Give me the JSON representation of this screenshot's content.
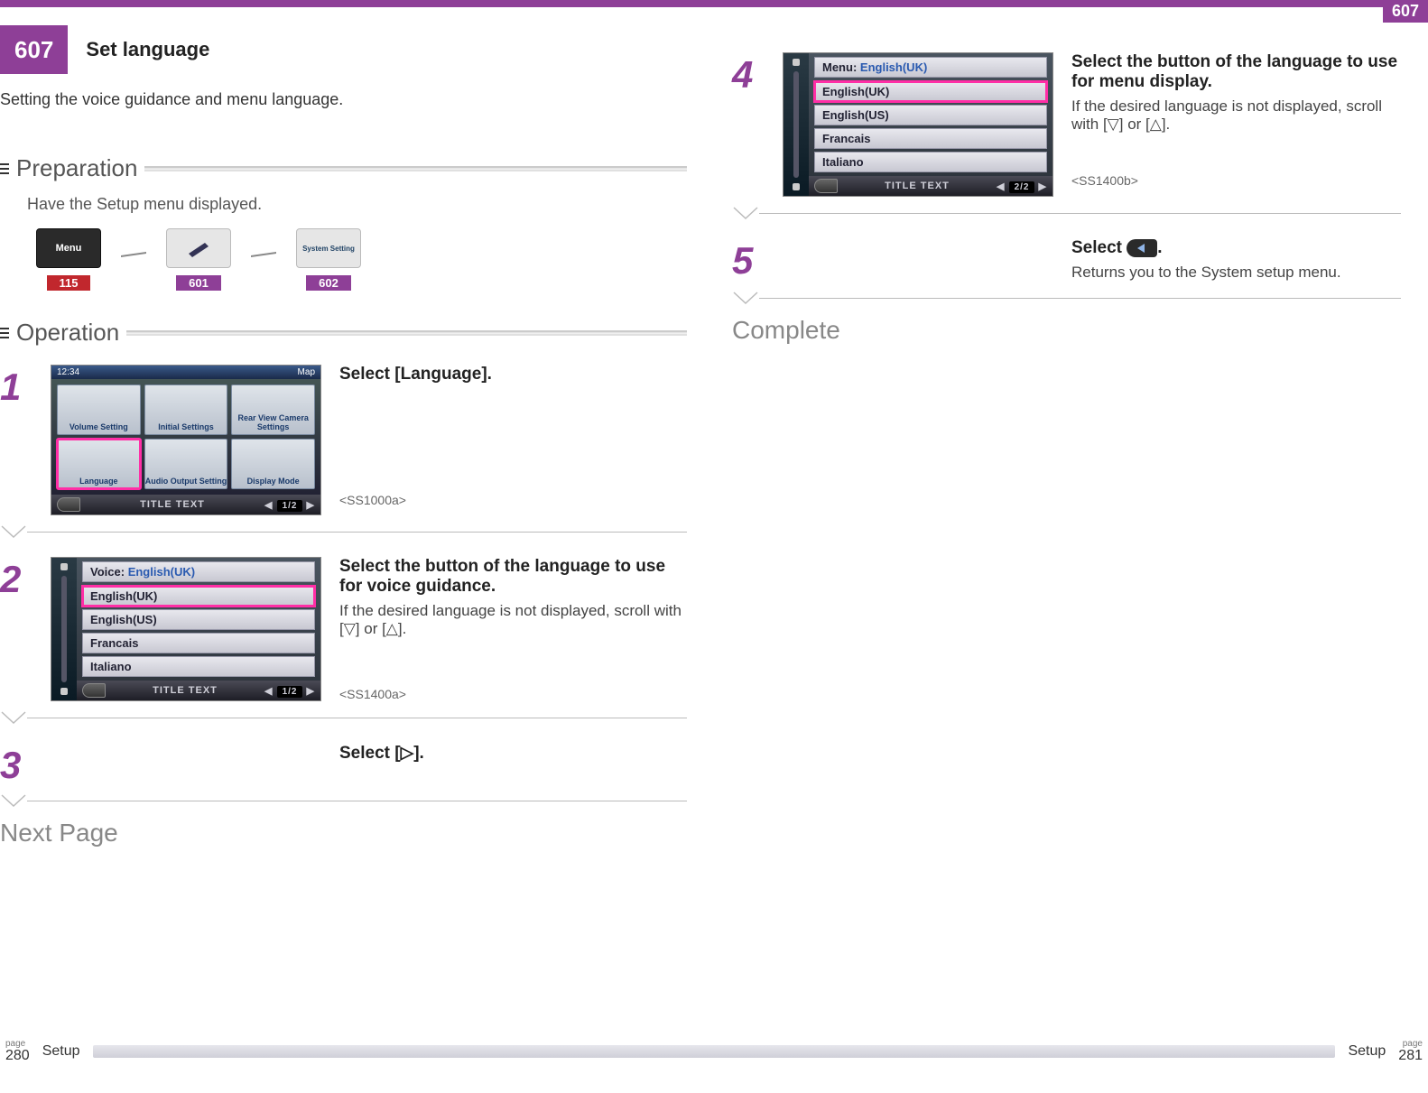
{
  "header": {
    "section_number": "607",
    "title": "Set language",
    "subtitle": "Setting the voice guidance and menu language.",
    "tab_right": "607"
  },
  "preparation": {
    "heading": "Preparation",
    "subtext": "Have the Setup menu displayed.",
    "items": [
      {
        "icon_label": "Menu",
        "ref": "115",
        "ref_style": "red"
      },
      {
        "icon_label": "",
        "ref": "601",
        "ref_style": "purple"
      },
      {
        "icon_label": "System Setting",
        "ref": "602",
        "ref_style": "purple"
      }
    ]
  },
  "operation": {
    "heading": "Operation"
  },
  "steps": [
    {
      "num": "1",
      "instruction": "Select [Language].",
      "detail": "",
      "ref": "<SS1000a>",
      "screenshot": {
        "type": "grid",
        "time": "12:34",
        "map_label": "Map",
        "tiles": [
          "Volume Setting",
          "Initial Settings",
          "Rear View Camera Settings",
          "Language",
          "Audio Output Setting",
          "Display Mode"
        ],
        "highlight_index": 3,
        "footer_title": "TITLE TEXT",
        "page": "1/2"
      }
    },
    {
      "num": "2",
      "instruction": "Select the button of the language to use for voice guidance.",
      "detail": "If the desired language is not displayed, scroll with [▽] or [△].",
      "ref": "<SS1400a>",
      "screenshot": {
        "type": "langlist",
        "title_prefix": "Voice:",
        "title_value": "English(UK)",
        "rows": [
          "English(UK)",
          "English(US)",
          "Francais",
          "Italiano"
        ],
        "highlight_index": 0,
        "footer_title": "TITLE TEXT",
        "page": "1/2"
      }
    },
    {
      "num": "3",
      "instruction": "Select [▷].",
      "detail": "",
      "ref": "",
      "screenshot": null
    },
    {
      "num": "4",
      "instruction": "Select the button of the language to use for menu display.",
      "detail": "If the desired language is not displayed, scroll with [▽] or [△].",
      "ref": "<SS1400b>",
      "screenshot": {
        "type": "langlist",
        "title_prefix": "Menu:",
        "title_value": "English(UK)",
        "rows": [
          "English(UK)",
          "English(US)",
          "Francais",
          "Italiano"
        ],
        "highlight_index": 0,
        "footer_title": "TITLE TEXT",
        "page": "2/2"
      }
    },
    {
      "num": "5",
      "instruction_prefix": "Select ",
      "instruction_suffix": ".",
      "detail": "Returns you to the System setup menu.",
      "ref": "",
      "screenshot": null,
      "return_icon": true
    }
  ],
  "flow": {
    "next_page": "Next Page",
    "complete": "Complete"
  },
  "footer": {
    "left_page_label": "page",
    "left_page_num": "280",
    "right_page_label": "page",
    "right_page_num": "281",
    "chapter": "Setup"
  }
}
